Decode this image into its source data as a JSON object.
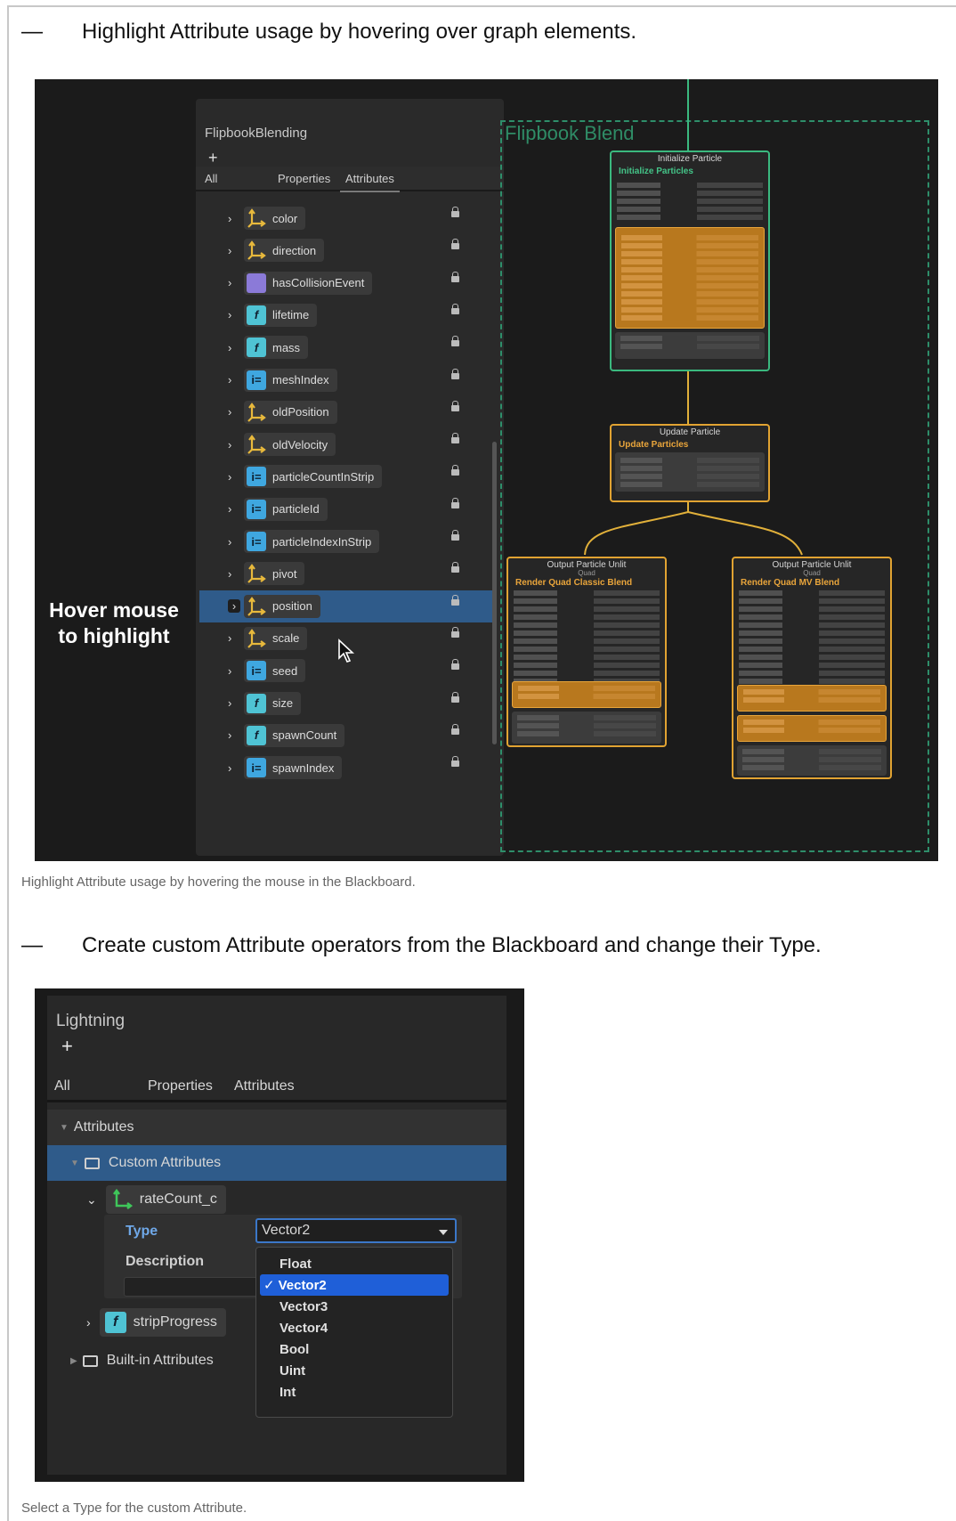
{
  "section1": {
    "bullet_dash": "—",
    "heading": "Highlight Attribute usage by hovering over graph elements.",
    "caption": "Highlight Attribute usage by hovering the mouse in the Blackboard.",
    "blackboard": {
      "title": "FlipbookBlending",
      "add": "+",
      "tabs": [
        "All",
        "Properties",
        "Attributes"
      ],
      "attributes": [
        {
          "name": "color",
          "type": "vector"
        },
        {
          "name": "direction",
          "type": "vector"
        },
        {
          "name": "hasCollisionEvent",
          "type": "bool"
        },
        {
          "name": "lifetime",
          "type": "float"
        },
        {
          "name": "mass",
          "type": "float"
        },
        {
          "name": "meshIndex",
          "type": "int"
        },
        {
          "name": "oldPosition",
          "type": "vector"
        },
        {
          "name": "oldVelocity",
          "type": "vector"
        },
        {
          "name": "particleCountInStrip",
          "type": "int"
        },
        {
          "name": "particleId",
          "type": "int"
        },
        {
          "name": "particleIndexInStrip",
          "type": "int"
        },
        {
          "name": "pivot",
          "type": "vector"
        },
        {
          "name": "position",
          "type": "vector",
          "highlighted": true
        },
        {
          "name": "scale",
          "type": "vector"
        },
        {
          "name": "seed",
          "type": "int"
        },
        {
          "name": "size",
          "type": "float"
        },
        {
          "name": "spawnCount",
          "type": "float"
        },
        {
          "name": "spawnIndex",
          "type": "int"
        }
      ]
    },
    "hover_text_line1": "Hover mouse",
    "hover_text_line2": "to highlight",
    "graph": {
      "frame_title": "Flipbook Blend",
      "init_head": "Initialize Particle",
      "init_name": "Initialize Particles",
      "update_head": "Update Particle",
      "update_name": "Update Particles",
      "out1_head": "Output Particle Unlit",
      "out1_sub": "Quad",
      "out1_name": "Render Quad Classic Blend",
      "out2_head": "Output Particle Unlit",
      "out2_sub": "Quad",
      "out2_name": "Render Quad MV Blend"
    }
  },
  "section2": {
    "bullet_dash": "—",
    "heading": "Create custom Attribute operators from the Blackboard and change their Type.",
    "caption": "Select a Type for the custom Attribute.",
    "blackboard": {
      "title": "Lightning",
      "add": "+",
      "tabs": [
        "All",
        "Properties",
        "Attributes"
      ],
      "attributes_section": "Attributes",
      "custom_section": "Custom Attributes",
      "custom_item": "rateCount_c",
      "type_label": "Type",
      "type_value": "Vector2",
      "description_label": "Description",
      "second_item": "stripProgress",
      "builtin_section": "Built-in Attributes"
    },
    "type_options": [
      "Float",
      "Vector2",
      "Vector3",
      "Vector4",
      "Bool",
      "Uint",
      "Int"
    ],
    "selected_option": "Vector2",
    "check_mark": "✓"
  },
  "colors": {
    "highlight_blue": "#2f5b8a",
    "context_orange": "#e1a332",
    "context_green": "#3bb97f",
    "selected_menu": "#1f5fd8"
  }
}
